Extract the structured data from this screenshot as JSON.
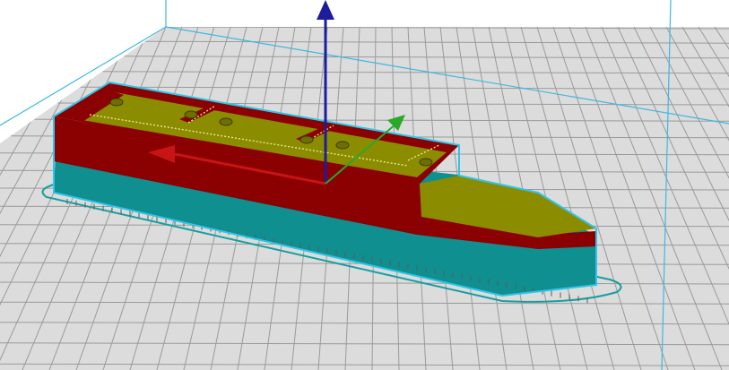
{
  "viewport": {
    "background": "#ffffff",
    "build_plate_color": "#d9d9d9",
    "grid_line_color": "#9a9a9a",
    "volume_edge_color": "#3fb8e0"
  },
  "model": {
    "hull_color": "#8b0000",
    "deck_color": "#8c8c00",
    "support_color": "#008a8a",
    "selection_outline_color": "#2fc4e8",
    "brim_outline_color": "#159f9f",
    "infill_line_color": "#e6e68c",
    "peg_color": "#6f6f00"
  },
  "gizmo": {
    "axis_z_color": "#1c1c9c",
    "axis_x_color": "#c81414",
    "axis_y_color": "#2aa82a",
    "axis_z_icon": "z-axis-arrow-icon",
    "axis_x_icon": "x-axis-arrow-icon",
    "axis_y_icon": "y-axis-arrow-icon"
  }
}
